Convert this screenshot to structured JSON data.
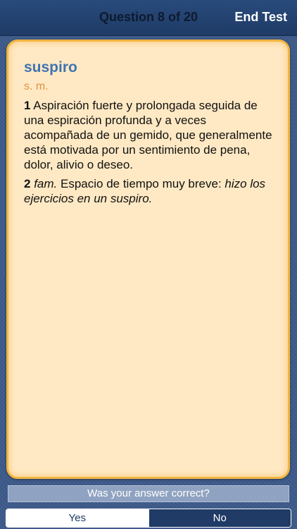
{
  "navbar": {
    "title": "Question 8 of 20",
    "end_test_label": "End Test"
  },
  "entry": {
    "headword": "suspiro",
    "part_of_speech": "s. m.",
    "sense1": {
      "number": "1",
      "text": "Aspiración fuerte y prolongada seguida de una espiración profunda y a veces acompañada de un gemido, que generalmente está motivada por un sentimiento de pena, dolor, alivio o deseo."
    },
    "sense2": {
      "number": "2",
      "register": "fam.",
      "text": "Espacio de tiempo muy breve:",
      "example": "hizo los ejercicios en un suspiro."
    }
  },
  "quiz": {
    "prompt": "Was your answer correct?",
    "yes_label": "Yes",
    "no_label": "No"
  },
  "colors": {
    "navbar": "#1f3b66",
    "card_background": "#ffe9c4",
    "card_border": "#f1b540",
    "headword": "#3f74b0",
    "part_of_speech": "#e3903a"
  }
}
